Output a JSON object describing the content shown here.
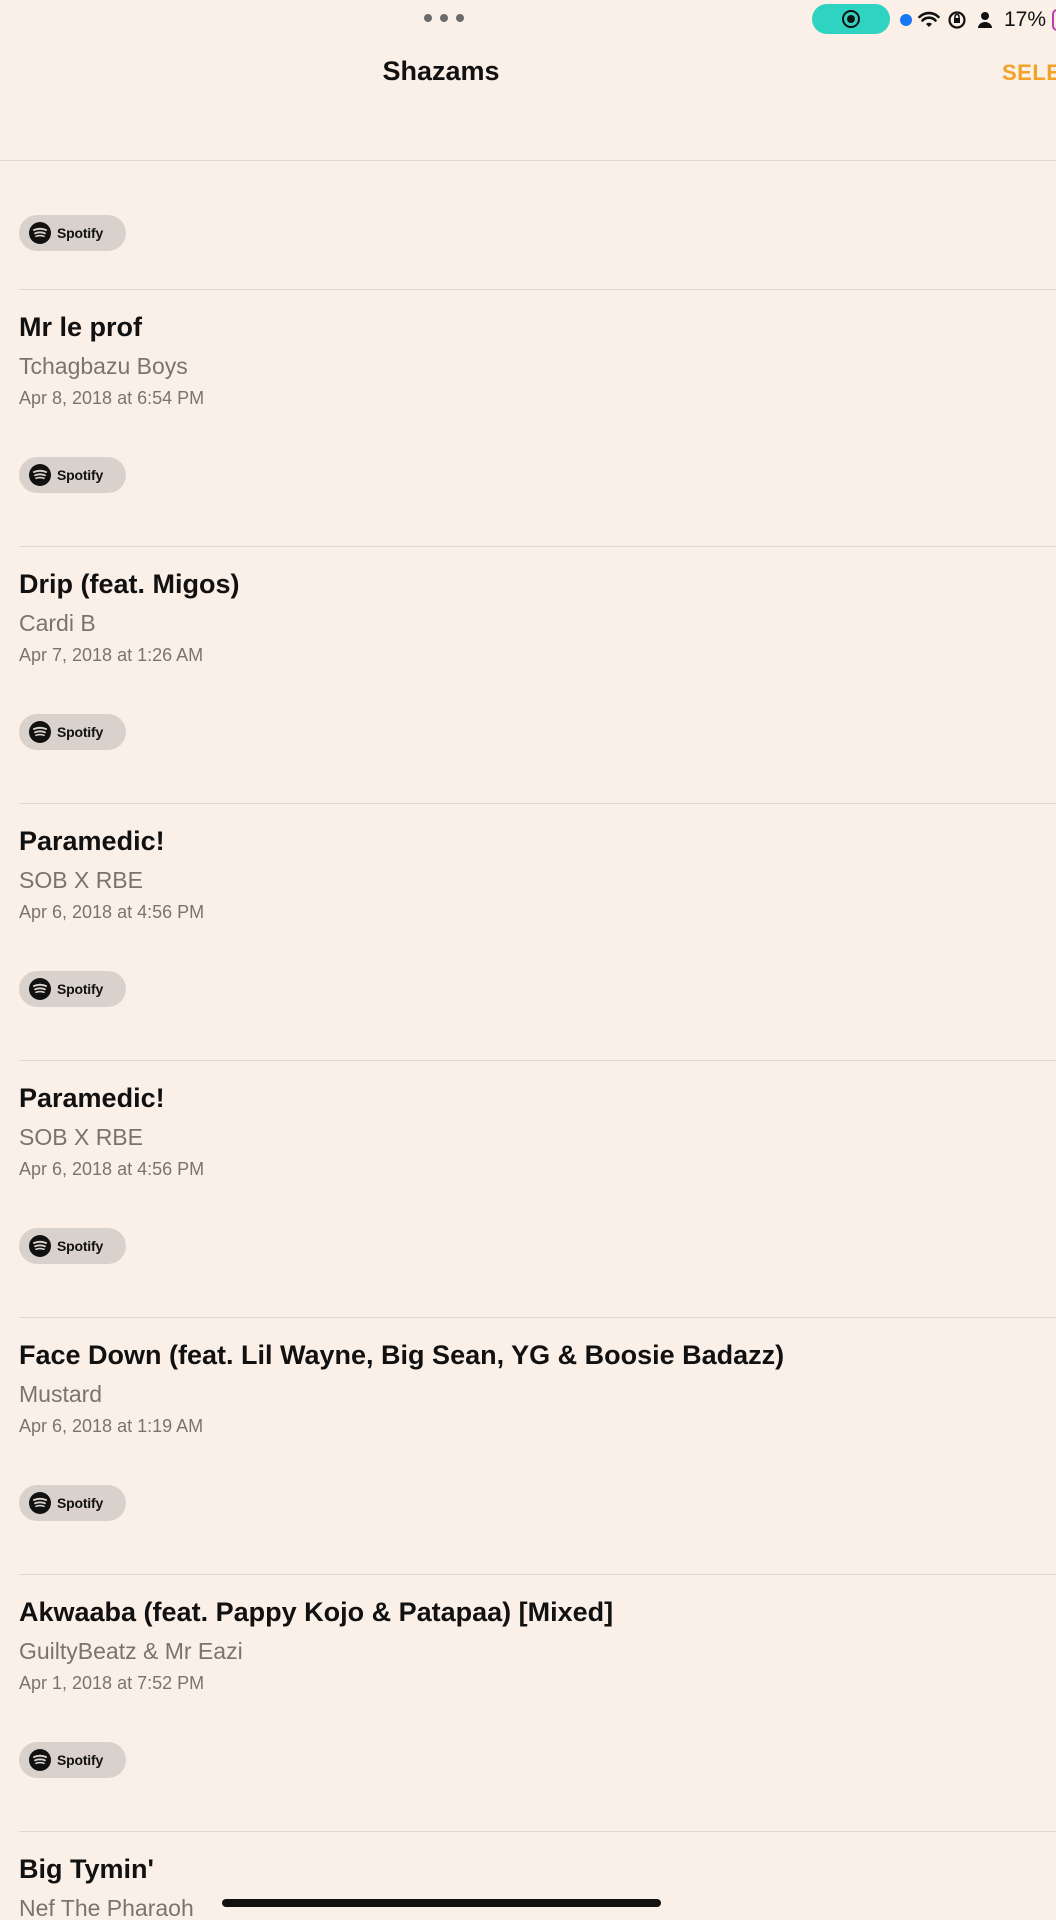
{
  "status_bar": {
    "battery_percent": "17%",
    "icons": [
      "more-dots-icon",
      "screen-record-icon",
      "location-dot-icon",
      "wifi-icon",
      "rotation-lock-icon",
      "person-icon",
      "battery-icon"
    ]
  },
  "nav": {
    "title": "Shazams",
    "select_label": "SELE"
  },
  "spotify_label": "Spotify",
  "rows": [
    {
      "title": "Mr le prof",
      "artist": "Tchagbazu Boys",
      "date": "Apr 8, 2018 at 6:54 PM",
      "button": "Spotify"
    },
    {
      "title": "Drip (feat. Migos)",
      "artist": "Cardi B",
      "date": "Apr 7, 2018 at 1:26 AM",
      "button": "Spotify"
    },
    {
      "title": "Paramedic!",
      "artist": "SOB X RBE",
      "date": "Apr 6, 2018 at 4:56 PM",
      "button": "Spotify"
    },
    {
      "title": "Paramedic!",
      "artist": "SOB X RBE",
      "date": "Apr 6, 2018 at 4:56 PM",
      "button": "Spotify"
    },
    {
      "title": "Face Down (feat. Lil Wayne, Big Sean, YG & Boosie Badazz)",
      "artist": "Mustard",
      "date": "Apr 6, 2018 at 1:19 AM",
      "button": "Spotify"
    },
    {
      "title": "Akwaaba (feat. Pappy Kojo & Patapaa) [Mixed]",
      "artist": "GuiltyBeatz & Mr Eazi",
      "date": "Apr 1, 2018 at 7:52 PM",
      "button": "Spotify"
    },
    {
      "title": "Big Tymin'",
      "artist": "Nef The Pharaoh",
      "date": "",
      "button": ""
    }
  ],
  "colors": {
    "background": "#FAF0E8",
    "accent": "#F1A227",
    "record_pill": "#2ED3C2",
    "spotify_button_bg": "#D9D2CC",
    "secondary_text": "#7a7470"
  }
}
